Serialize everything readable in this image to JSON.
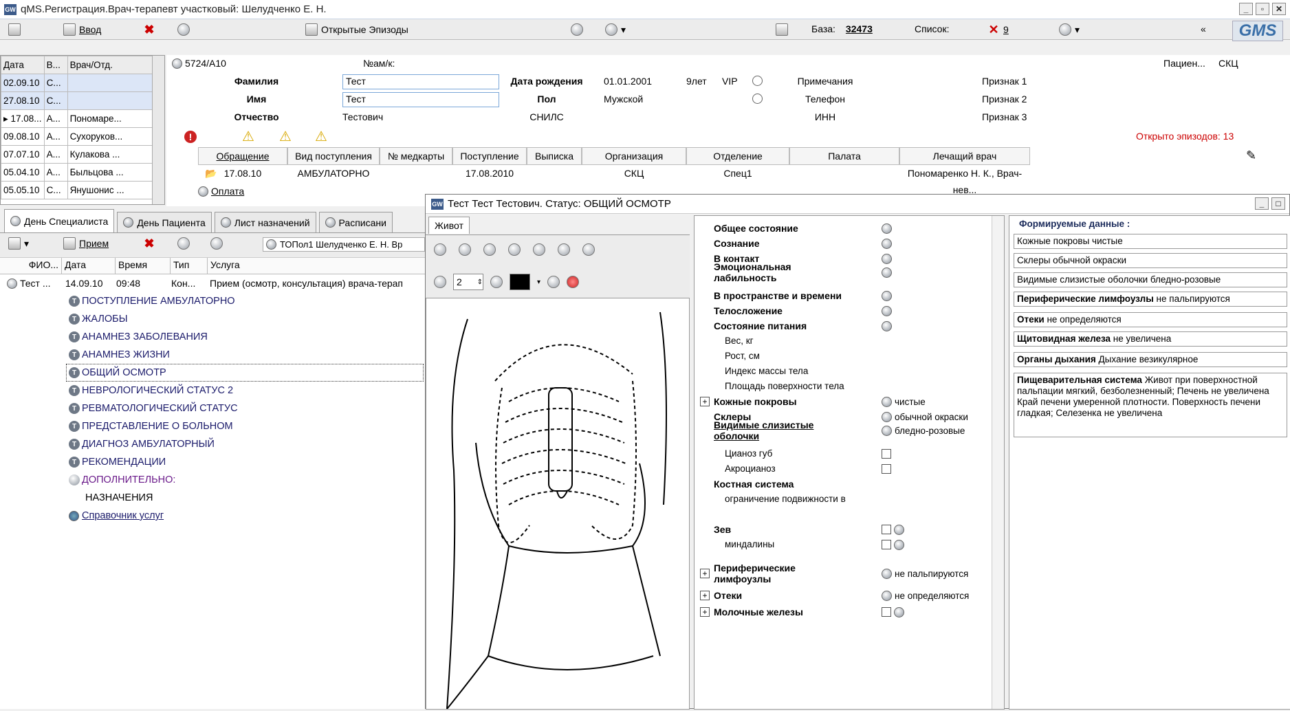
{
  "window": {
    "title": "qMS.Регистрация.Врач-терапевт участковый: Шелудченко Е. Н.",
    "app_logo": "GW"
  },
  "toolbar": {
    "enter_label": "Ввод",
    "open_episodes_label": "Открытые Эпизоды",
    "base_label": "База:",
    "base_value": "32473",
    "list_label": "Список:",
    "list_value": "9",
    "logo": "GMS"
  },
  "episodes": {
    "headers": [
      "Дата",
      "В...",
      "Врач/Отд."
    ],
    "rows": [
      [
        "02.09.10",
        "С...",
        ""
      ],
      [
        "27.08.10",
        "С...",
        ""
      ],
      [
        "▸ 17.08...",
        "А...",
        "Пономаре..."
      ],
      [
        "09.08.10",
        "А...",
        "Сухоруков..."
      ],
      [
        "07.07.10",
        "А...",
        "Кулакова ..."
      ],
      [
        "05.04.10",
        "А...",
        "Быльцова ..."
      ],
      [
        "05.05.10",
        "С...",
        "Янушонис ..."
      ]
    ]
  },
  "patient": {
    "id": "5724/А10",
    "card_label": "№ам/к:",
    "pacient_label": "Пациен...",
    "pacient_value": "СКЦ",
    "surname_label": "Фамилия",
    "surname": "Тест",
    "name_label": "Имя",
    "name": "Тест",
    "patronymic_label": "Отчество",
    "patronymic": "Тестович",
    "dob_label": "Дата рождения",
    "dob": "01.01.2001",
    "age": "9лет",
    "vip": "VIP",
    "sex_label": "Пол",
    "sex": "Мужской",
    "snils_label": "СНИЛС",
    "notes_label": "Примечания",
    "phone_label": "Телефон",
    "inn_label": "ИНН",
    "sign1": "Признак 1",
    "sign2": "Признак 2",
    "sign3": "Признак 3",
    "open_episodes": "Открыто эпизодов: 13",
    "grid_headers": [
      "Обращение",
      "Вид поступления",
      "№ медкарты",
      "Поступление",
      "Выписка",
      "Организация",
      "Отделение",
      "Палата",
      "Лечащий врач"
    ],
    "grid_row": [
      "17.08.10",
      "АМБУЛАТОРНО",
      "",
      "17.08.2010",
      "",
      "СКЦ",
      "Спец1",
      "",
      "Пономаренко Н. К., Врач-нев..."
    ],
    "payment": "Оплата"
  },
  "tabs": [
    "День Специалиста",
    "День Пациента",
    "Лист назначений",
    "Расписани"
  ],
  "left": {
    "reception_label": "Прием",
    "doctor_label": "ТОПол1 Шелудченко Е. Н. Вр",
    "headers": [
      "ФИО...",
      "Дата",
      "Время",
      "Тип",
      "Услуга"
    ],
    "visit": [
      "Тест ...",
      "14.09.10",
      "09:48",
      "Кон...",
      "Прием (осмотр, консультация) врача-терап"
    ],
    "tree": [
      "ПОСТУПЛЕНИЕ АМБУЛАТОРНО",
      "ЖАЛОБЫ",
      "АНАМНЕЗ ЗАБОЛЕВАНИЯ",
      "АНАМНЕЗ ЖИЗНИ",
      "ОБЩИЙ ОСМОТР",
      "НЕВРОЛОГИЧЕСКИЙ СТАТУС 2",
      "РЕВМАТОЛОГИЧЕСКИЙ СТАТУС",
      "ПРЕДСТАВЛЕНИЕ О БОЛЬНОМ",
      "ДИАГНОЗ АМБУЛАТОРНЫЙ",
      "РЕКОМЕНДАЦИИ",
      "ДОПОЛНИТЕЛЬНО:"
    ],
    "appointments": "НАЗНАЧЕНИЯ",
    "services": "Справочник услуг"
  },
  "dialog": {
    "title": "Тест Тест Тестович. Статус: ОБЩИЙ ОСМОТР",
    "tab": "Живот",
    "pen_width": "2",
    "form": [
      {
        "label": "Общее состояние",
        "value": ""
      },
      {
        "label": "Сознание",
        "value": ""
      },
      {
        "label": "В контакт",
        "value": ""
      },
      {
        "label": "Эмоциональная лабильность",
        "value": ""
      },
      {
        "label": "В пространстве и времени",
        "value": ""
      },
      {
        "label": "Телосложение",
        "value": ""
      },
      {
        "label": "Состояние питания",
        "value": ""
      },
      {
        "label": "Вес, кг",
        "value": ""
      },
      {
        "label": "Рост, см",
        "value": ""
      },
      {
        "label": "Индекс массы тела",
        "value": ""
      },
      {
        "label": "Площадь поверхности тела",
        "value": ""
      },
      {
        "label": "Кожные покровы",
        "value": "чистые"
      },
      {
        "label": "Склеры",
        "value": "обычной окраски"
      },
      {
        "label": "Видимые слизистые оболочки",
        "value": "бледно-розовые"
      },
      {
        "label": "Цианоз губ",
        "value": ""
      },
      {
        "label": "Акроцианоз",
        "value": ""
      },
      {
        "label": "Костная система",
        "value": ""
      },
      {
        "label": "ограничение подвижности в",
        "value": ""
      },
      {
        "label": "Зев",
        "value": ""
      },
      {
        "label": "миндалины",
        "value": ""
      },
      {
        "label": "Периферические лимфоузлы",
        "value": "не пальпируются"
      },
      {
        "label": "Отеки",
        "value": "не определяются"
      },
      {
        "label": "Молочные железы",
        "value": ""
      }
    ],
    "generated_title": "Формируемые данные :",
    "generated": [
      {
        "bold": "",
        "text": "Кожные покровы чистые"
      },
      {
        "bold": "",
        "text": "Склеры обычной окраски"
      },
      {
        "bold": "",
        "text": "Видимые слизистые оболочки бледно-розовые"
      },
      {
        "bold": "Периферические лимфоузлы",
        "text": " не пальпируются"
      },
      {
        "bold": "Отеки",
        "text": " не определяются"
      },
      {
        "bold": "Щитовидная железа",
        "text": " не увеличена"
      },
      {
        "bold": "Органы дыхания",
        "text": " Дыхание везикулярное"
      },
      {
        "bold": "Пищеварительная система",
        "text": " Живот при поверхностной пальпации мягкий, безболезненный; Печень не увеличена  Край печени умеренной плотности. Поверхность печени гладкая; Селезенка не увеличена"
      }
    ]
  }
}
